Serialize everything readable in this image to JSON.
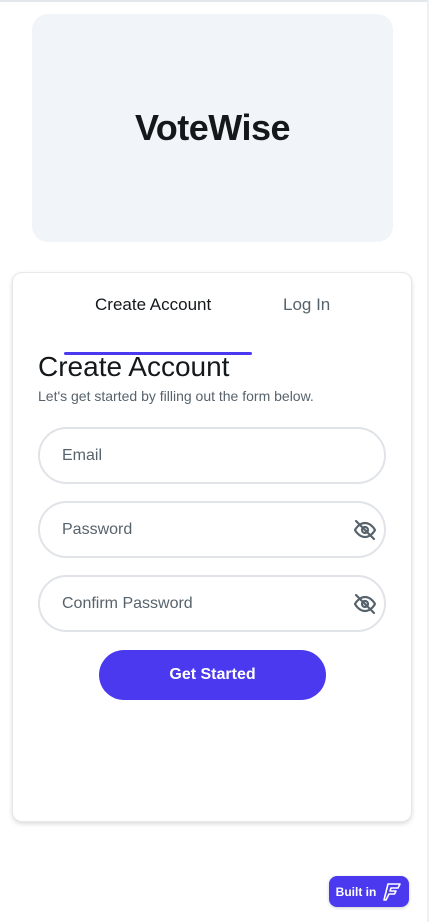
{
  "app": {
    "title": "VoteWise"
  },
  "tabs": [
    {
      "label": "Create Account",
      "active": true
    },
    {
      "label": "Log In",
      "active": false
    }
  ],
  "form": {
    "title": "Create Account",
    "subtitle": "Let's get started by filling out the form below.",
    "fields": {
      "email": {
        "placeholder": "Email",
        "value": ""
      },
      "password": {
        "placeholder": "Password",
        "value": "",
        "icon": "eye-off-icon"
      },
      "confirm_password": {
        "placeholder": "Confirm Password",
        "value": "",
        "icon": "eye-off-icon"
      }
    },
    "submit_label": "Get Started"
  },
  "badge": {
    "label": "Built in",
    "icon": "flutterflow-logo-icon"
  },
  "colors": {
    "primary": "#4b39ef",
    "text_primary": "#14181b",
    "text_secondary": "#57636c",
    "hero_background": "#f1f4f8",
    "field_border": "#e0e3e7"
  }
}
